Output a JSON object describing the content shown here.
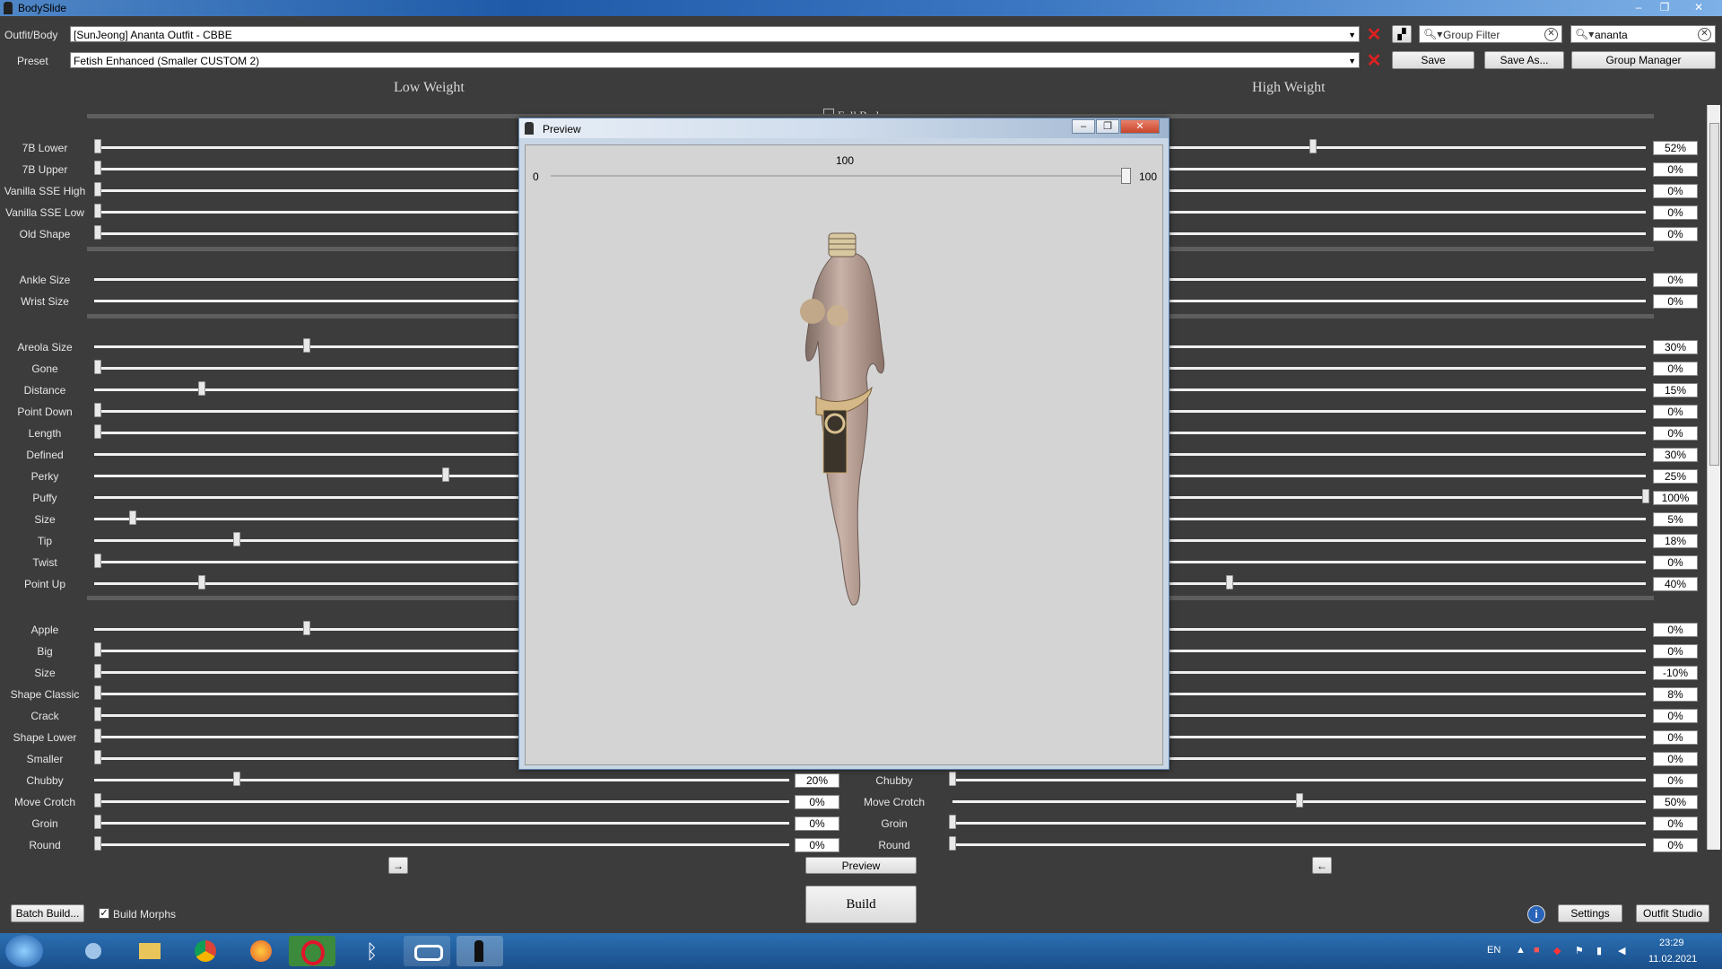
{
  "app": {
    "title": "BodySlide"
  },
  "window_controls": {
    "minimize": "–",
    "maximize": "❐",
    "close": "✕"
  },
  "top": {
    "outfit_label": "Outfit/Body",
    "outfit_value": "[SunJeong] Ananta Outfit - CBBE",
    "preset_label": "Preset",
    "preset_value": "Fetish Enhanced (Smaller CUSTOM 2)",
    "group_filter_placeholder": "Group Filter",
    "outfit_filter_value": "ananta",
    "save": "Save",
    "save_as": "Save As...",
    "group_manager": "Group Manager"
  },
  "headers": {
    "low": "Low Weight",
    "high": "High Weight",
    "group_partial": "Full Body"
  },
  "sliders": [
    {
      "name": "7B Lower",
      "low": 0,
      "high": 52,
      "high_text": "52%"
    },
    {
      "name": "7B Upper",
      "low": 0,
      "high": 0,
      "high_text": "0%"
    },
    {
      "name": "Vanilla SSE High",
      "low": 0,
      "high": 0,
      "high_text": "0%"
    },
    {
      "name": "Vanilla SSE Low",
      "low": 0,
      "high": 0,
      "high_text": "0%"
    },
    {
      "name": "Old Shape",
      "low": 0,
      "high": 0,
      "high_text": "0%"
    },
    {
      "name": "Ankle Size",
      "low": null,
      "high": null,
      "high_text": "0%"
    },
    {
      "name": "Wrist Size",
      "low": null,
      "high": null,
      "high_text": "0%"
    },
    {
      "name": "Areola Size",
      "low": 30,
      "high": null,
      "high_text": "30%"
    },
    {
      "name": "Gone",
      "low": 0,
      "high": 0,
      "high_text": "0%"
    },
    {
      "name": "Distance",
      "low": 15,
      "high": null,
      "high_text": "15%"
    },
    {
      "name": "Point Down",
      "low": 0,
      "high": 0,
      "high_text": "0%"
    },
    {
      "name": "Length",
      "low": 0,
      "high": 0,
      "high_text": "0%"
    },
    {
      "name": "Defined",
      "low": null,
      "high": null,
      "high_text": "30%"
    },
    {
      "name": "Perky",
      "low": 50,
      "high": null,
      "high_text": "25%"
    },
    {
      "name": "Puffy",
      "low": null,
      "high": 100,
      "high_text": "100%"
    },
    {
      "name": "Size",
      "low": 5,
      "high": null,
      "high_text": "5%"
    },
    {
      "name": "Tip",
      "low": 20,
      "high": null,
      "high_text": "18%"
    },
    {
      "name": "Twist",
      "low": 0,
      "high": 0,
      "high_text": "0%"
    },
    {
      "name": "Point Up",
      "low": 15,
      "high": 40,
      "high_text": "40%"
    },
    {
      "name": "Apple",
      "low": 30,
      "high": null,
      "high_text": "0%"
    },
    {
      "name": "Big",
      "low": 0,
      "high": 0,
      "high_text": "0%"
    },
    {
      "name": "Size",
      "low": 0,
      "high": 0,
      "high_text": "-10%"
    },
    {
      "name": "Shape Classic",
      "low": 0,
      "high": 0,
      "high_text": "8%"
    },
    {
      "name": "Crack",
      "low": 0,
      "high": 0,
      "high_text": "0%"
    },
    {
      "name": "Shape Lower",
      "low": 0,
      "high": 0,
      "high_text": "0%"
    },
    {
      "name": "Smaller",
      "low": 0,
      "high": 0,
      "high_text": "0%"
    },
    {
      "name": "Chubby",
      "low": 20,
      "high": 0,
      "high_text": "0%",
      "low_text": "20%",
      "name2": "Chubby"
    },
    {
      "name": "Move Crotch",
      "low": 0,
      "high": 50,
      "high_text": "50%",
      "low_text": "0%",
      "name2": "Move Crotch"
    },
    {
      "name": "Groin",
      "low": 0,
      "high": 0,
      "high_text": "0%",
      "low_text": "0%",
      "name2": "Groin"
    },
    {
      "name": "Round",
      "low": 0,
      "high": 0,
      "high_text": "0%",
      "low_text": "0%",
      "name2": "Round"
    }
  ],
  "preview_window": {
    "title": "Preview",
    "slider_min": "0",
    "slider_max": "100",
    "slider_value": "100"
  },
  "bottom": {
    "arrow_right": "→",
    "arrow_left": "←",
    "preview": "Preview",
    "build": "Build",
    "batch_build": "Batch Build...",
    "build_morphs": "Build Morphs",
    "settings": "Settings",
    "outfit_studio": "Outfit Studio",
    "info": "i"
  },
  "taskbar": {
    "lang": "EN",
    "time": "23:29",
    "date": "11.02.2021"
  }
}
